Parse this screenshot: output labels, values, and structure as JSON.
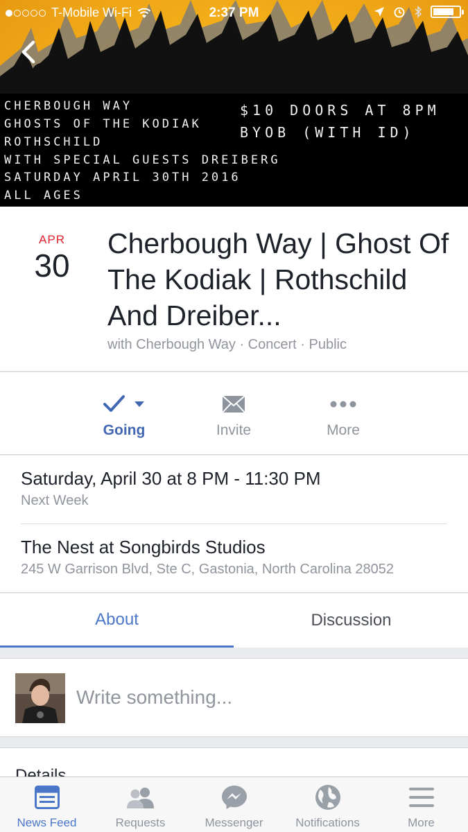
{
  "status_bar": {
    "carrier": "T-Mobile Wi-Fi",
    "signal_strength": 1,
    "signal_max": 5,
    "time": "2:37 PM",
    "battery_level": 0.8
  },
  "cover": {
    "poster_left": [
      "CHERBOUGH WAY",
      "GHOSTS OF THE KODIAK",
      "ROTHSCHILD",
      "WITH SPECIAL GUESTS DREIBERG",
      "SATURDAY APRIL 30TH 2016",
      "ALL AGES"
    ],
    "poster_right": [
      "$10 DOORS AT 8PM",
      "BYOB (WITH ID)"
    ]
  },
  "event": {
    "month": "APR",
    "day": "30",
    "title": "Cherbough Way | Ghost Of The Kodiak | Rothschild And Dreiber...",
    "subtitle": "with Cherbough Way · Concert · Public"
  },
  "actions": {
    "going": "Going",
    "invite": "Invite",
    "more": "More"
  },
  "info": {
    "datetime": "Saturday, April 30 at 8 PM - 11:30 PM",
    "relative": "Next Week",
    "venue": "The Nest at Songbirds Studios",
    "address": "245 W Garrison Blvd, Ste C, Gastonia, North Carolina 28052"
  },
  "tabs": {
    "about": "About",
    "discussion": "Discussion"
  },
  "composer": {
    "placeholder": "Write something..."
  },
  "details": {
    "title": "Details"
  },
  "tab_bar": {
    "items": [
      {
        "label": "News Feed",
        "icon": "news-feed-icon",
        "active": true
      },
      {
        "label": "Requests",
        "icon": "requests-icon",
        "active": false
      },
      {
        "label": "Messenger",
        "icon": "messenger-icon",
        "active": false
      },
      {
        "label": "Notifications",
        "icon": "globe-icon",
        "active": false
      },
      {
        "label": "More",
        "icon": "menu-icon",
        "active": false
      }
    ]
  },
  "colors": {
    "accent": "#4a76c8",
    "date_red": "#e0212f",
    "muted": "#90949c"
  }
}
